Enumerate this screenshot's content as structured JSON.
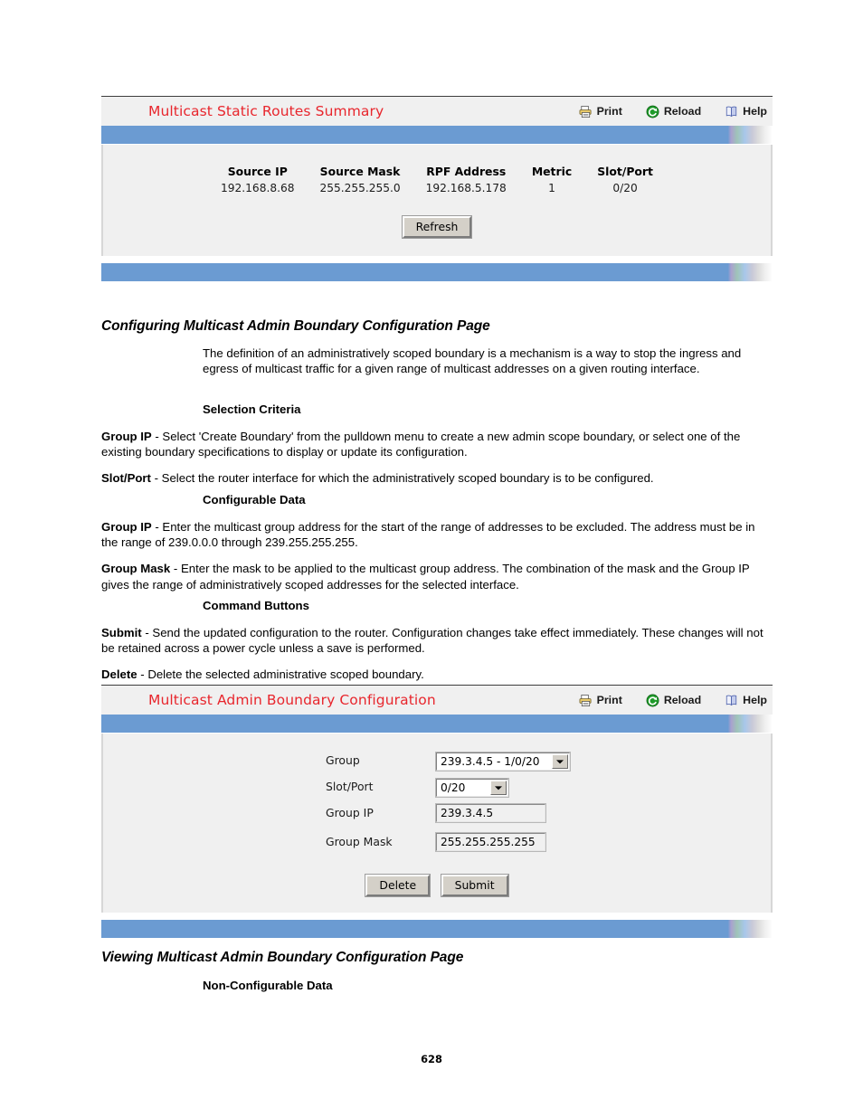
{
  "summary_panel": {
    "title": "Multicast Static Routes Summary",
    "toolbar": [
      {
        "label": "Print",
        "icon": "printer-icon"
      },
      {
        "label": "Reload",
        "icon": "reload-icon"
      },
      {
        "label": "Help",
        "icon": "help-book-icon"
      }
    ],
    "table": {
      "headers": [
        "Source IP",
        "Source Mask",
        "RPF Address",
        "Metric",
        "Slot/Port"
      ],
      "rows": [
        [
          "192.168.8.68",
          "255.255.255.0",
          "192.168.5.178",
          "1",
          "0/20"
        ]
      ]
    },
    "refresh_label": "Refresh"
  },
  "config_section": {
    "heading": "Configuring Multicast Admin Boundary Configuration Page",
    "intro": "The definition of an administratively scoped boundary is a mechanism is a way to stop the ingress and egress of multicast traffic for a given range of multicast addresses on a given routing interface.",
    "selection_criteria_head": "Selection Criteria",
    "selection_criteria": [
      {
        "term": "Group IP",
        "desc": " - Select 'Create Boundary' from the pulldown menu to create a new admin scope boundary, or select one of the existing boundary specifications to display or update its configuration."
      },
      {
        "term": "Slot/Port",
        "desc": " - Select the router interface for which the administratively scoped boundary is to be configured."
      }
    ],
    "configurable_data_head": "Configurable Data",
    "configurable_data": [
      {
        "term": "Group IP",
        "desc": " - Enter the multicast group address for the start of the range of addresses to be excluded. The address must be in the range of 239.0.0.0 through 239.255.255.255."
      },
      {
        "term": "Group Mask",
        "desc": " - Enter the mask to be applied to the multicast group address. The combination of the mask and the Group IP gives the range of administratively scoped addresses for the selected interface."
      }
    ],
    "command_buttons_head": "Command Buttons",
    "command_buttons": [
      {
        "term": "Submit",
        "desc": " - Send the updated configuration to the router. Configuration changes take effect immediately. These changes will not be retained across a power cycle unless a save is performed."
      },
      {
        "term": "Delete",
        "desc": " - Delete the selected administrative scoped boundary."
      }
    ]
  },
  "boundary_panel": {
    "title": "Multicast Admin Boundary Configuration",
    "toolbar": [
      {
        "label": "Print",
        "icon": "printer-icon"
      },
      {
        "label": "Reload",
        "icon": "reload-icon"
      },
      {
        "label": "Help",
        "icon": "help-book-icon"
      }
    ],
    "fields": {
      "group_label": "Group",
      "group_value": "239.3.4.5 - 1/0/20",
      "slot_port_label": "Slot/Port",
      "slot_port_value": "0/20",
      "group_ip_label": "Group IP",
      "group_ip_value": "239.3.4.5",
      "group_mask_label": "Group Mask",
      "group_mask_value": "255.255.255.255"
    },
    "delete_label": "Delete",
    "submit_label": "Submit"
  },
  "viewing_section": {
    "heading": "Viewing Multicast Admin Boundary Configuration Page",
    "non_configurable_head": "Non-Configurable Data"
  },
  "footer": {
    "page_number": "628"
  },
  "colors": {
    "panel_title_red": "#e8262d",
    "bar_blue": "#6b9bd2",
    "content_gray": "#f0f0f0",
    "button_face": "#d4d0c8"
  }
}
